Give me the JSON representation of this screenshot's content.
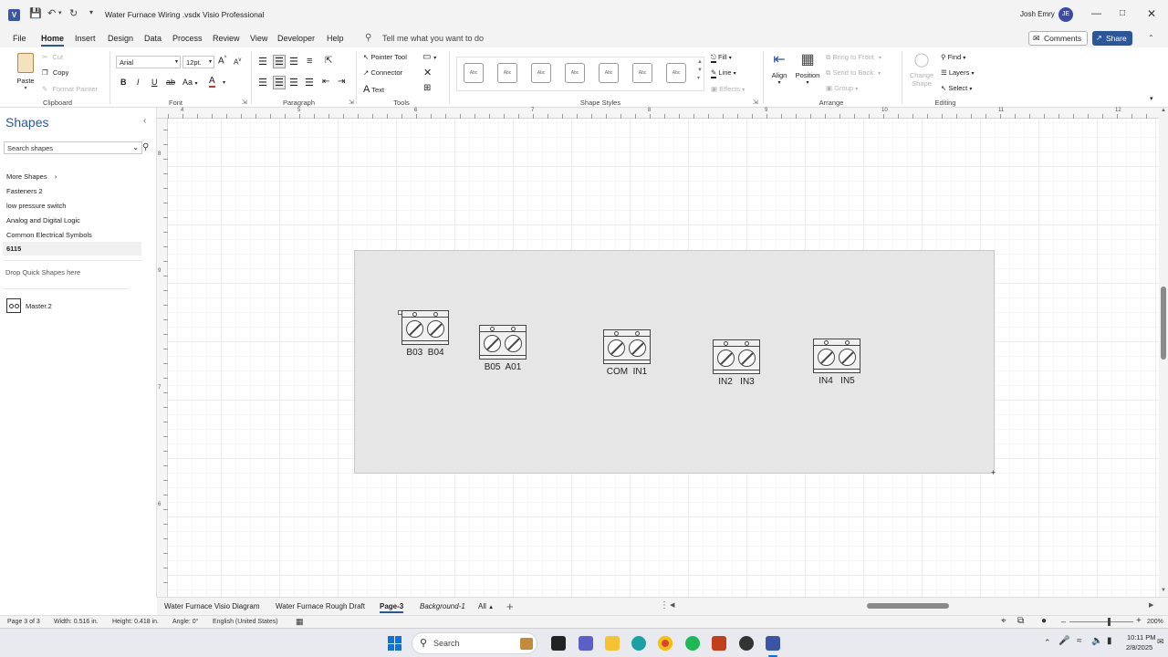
{
  "titlebar": {
    "doc_title": "Water Furnace Wiring .vsdx",
    "app_name": "Visio Professional",
    "separator": "-",
    "user": "Josh Emry",
    "initials": "JE"
  },
  "tabs": [
    "File",
    "Home",
    "Insert",
    "Design",
    "Data",
    "Process",
    "Review",
    "View",
    "Developer",
    "Help"
  ],
  "tell_me": "Tell me what you want to do",
  "comments_label": "Comments",
  "share_label": "Share",
  "ribbon": {
    "clipboard": {
      "paste": "Paste",
      "cut": "Cut",
      "copy": "Copy",
      "format_painter": "Format Painter",
      "label": "Clipboard"
    },
    "font": {
      "name": "Arial",
      "size": "12pt.",
      "label": "Font",
      "aa": "Aa"
    },
    "paragraph": {
      "label": "Paragraph"
    },
    "tools": {
      "pointer": "Pointer Tool",
      "connector": "Connector",
      "text": "Text",
      "label": "Tools"
    },
    "shape_styles": {
      "sample": "Abc",
      "label": "Shape Styles",
      "fill": "Fill",
      "line": "Line",
      "effects": "Effects"
    },
    "arrange": {
      "align": "Align",
      "position": "Position",
      "bring_front": "Bring to Front",
      "send_back": "Send to Back",
      "group": "Group",
      "label": "Arrange"
    },
    "editing": {
      "change_shape_1": "Change",
      "change_shape_2": "Shape",
      "find": "Find",
      "layers": "Layers",
      "select": "Select",
      "label": "Editing"
    }
  },
  "shapes_pane": {
    "title": "Shapes",
    "search_placeholder": "Search shapes",
    "more_shapes": "More Shapes",
    "stencils": [
      "Fasteners 2",
      "low pressure switch",
      "Analog and Digital Logic",
      "Common Electrical Symbols",
      "6115"
    ],
    "drop_quick": "Drop Quick Shapes here",
    "master": "Master.2"
  },
  "ruler_top": [
    "4",
    "5",
    "6",
    "7",
    "8",
    "9",
    "10",
    "11",
    "12"
  ],
  "ruler_left": [
    "8",
    "9",
    "7",
    "6"
  ],
  "terminals": [
    {
      "label": "B03  B04"
    },
    {
      "label": "B05  A01"
    },
    {
      "label": "COM  IN1"
    },
    {
      "label": "IN2   IN3"
    },
    {
      "label": "IN4   IN5"
    }
  ],
  "page_tabs": [
    "Water Furnace Visio Diagram",
    "Water Furnace Rough Draft",
    "Page-3",
    "Background-1",
    "All"
  ],
  "status": {
    "page": "Page 3 of 3",
    "width": "Width: 0.516 in.",
    "height": "Height: 0.418 in.",
    "angle": "Angle: 0°",
    "language": "English (United States)",
    "zoom": "200%"
  },
  "taskbar": {
    "search": "Search",
    "time": "10:11 PM",
    "date": "2/8/2025"
  }
}
